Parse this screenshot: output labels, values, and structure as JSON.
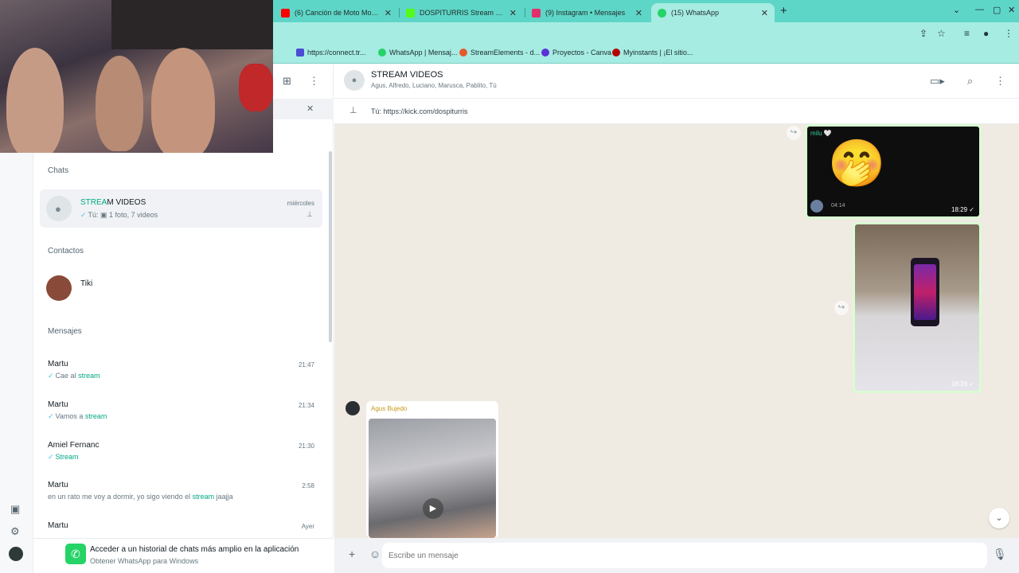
{
  "browser": {
    "tabs": [
      {
        "label": "(6) Canción de Moto Moto (M...",
        "icon_color": "#ff0000"
      },
      {
        "label": "DOSPITURRIS Stream - Wat...",
        "icon_color": "#53fc18"
      },
      {
        "label": "(9) Instagram • Mensajes",
        "icon_color": "#e1306c"
      },
      {
        "label": "(15) WhatsApp",
        "icon_color": "#25d366"
      }
    ],
    "newtab_icon": "plus-icon",
    "bookmarks": [
      {
        "label": "https://connect.tr...",
        "color": "#4b4bd6"
      },
      {
        "label": "WhatsApp | Mensaj...",
        "color": "#25d366"
      },
      {
        "label": "StreamElements - d...",
        "color": "#e55a2b"
      },
      {
        "label": "Proyectos - Canva",
        "color": "#5a32d6"
      },
      {
        "label": "Myinstants | ¡El sitio...",
        "color": "#b30000"
      }
    ]
  },
  "left": {
    "sections": {
      "chats": "Chats",
      "contacts": "Contactos",
      "messages": "Mensajes"
    },
    "pinned_chat": {
      "name_pre": "STREA",
      "name_hl": "M",
      "name_post": " VIDEOS",
      "time": "miércoles",
      "preview": "Tú: ▣ 1 foto, 7 videos"
    },
    "contact": {
      "name": "Tiki"
    },
    "messages": [
      {
        "name": "Martu",
        "time": "21:47",
        "pre": "Cae al ",
        "hl": "stream",
        "post": "",
        "check": true
      },
      {
        "name": "Martu",
        "time": "21:34",
        "pre": "Vamos a ",
        "hl": "stream",
        "post": "",
        "check": true
      },
      {
        "name": "Amiel Fernanc",
        "time": "21:30",
        "pre": "",
        "hl": "Stream",
        "post": "",
        "check": true
      },
      {
        "name": "Martu",
        "time": "2:58",
        "pre": "en un rato me voy a dormir, yo sigo viendo el ",
        "hl": "stream",
        "post": " jaajja",
        "check": false
      },
      {
        "name": "Martu",
        "time": "Ayer",
        "pre": "",
        "hl": "",
        "post": "",
        "check": false
      }
    ],
    "promo": {
      "title": "Acceder a un historial de chats más amplio en la aplicación",
      "subtitle": "Obtener WhatsApp para Windows"
    }
  },
  "conversation": {
    "title": "STREAM VIDEOS",
    "participants": "Agus, Alfredo, Luciano, Marusca, Pablito, Tú",
    "pinned_message": "Tú: https://kick.com/dospiturris",
    "messages": [
      {
        "type": "video",
        "sender": "milu 🤍",
        "time": "18:29",
        "duration": "04:14",
        "emoji": "🤭"
      },
      {
        "type": "image",
        "time": "18:29"
      },
      {
        "type": "video",
        "sender": "Agus Bujedo",
        "incoming": true
      }
    ],
    "input_placeholder": "Escribe un mensaje"
  }
}
